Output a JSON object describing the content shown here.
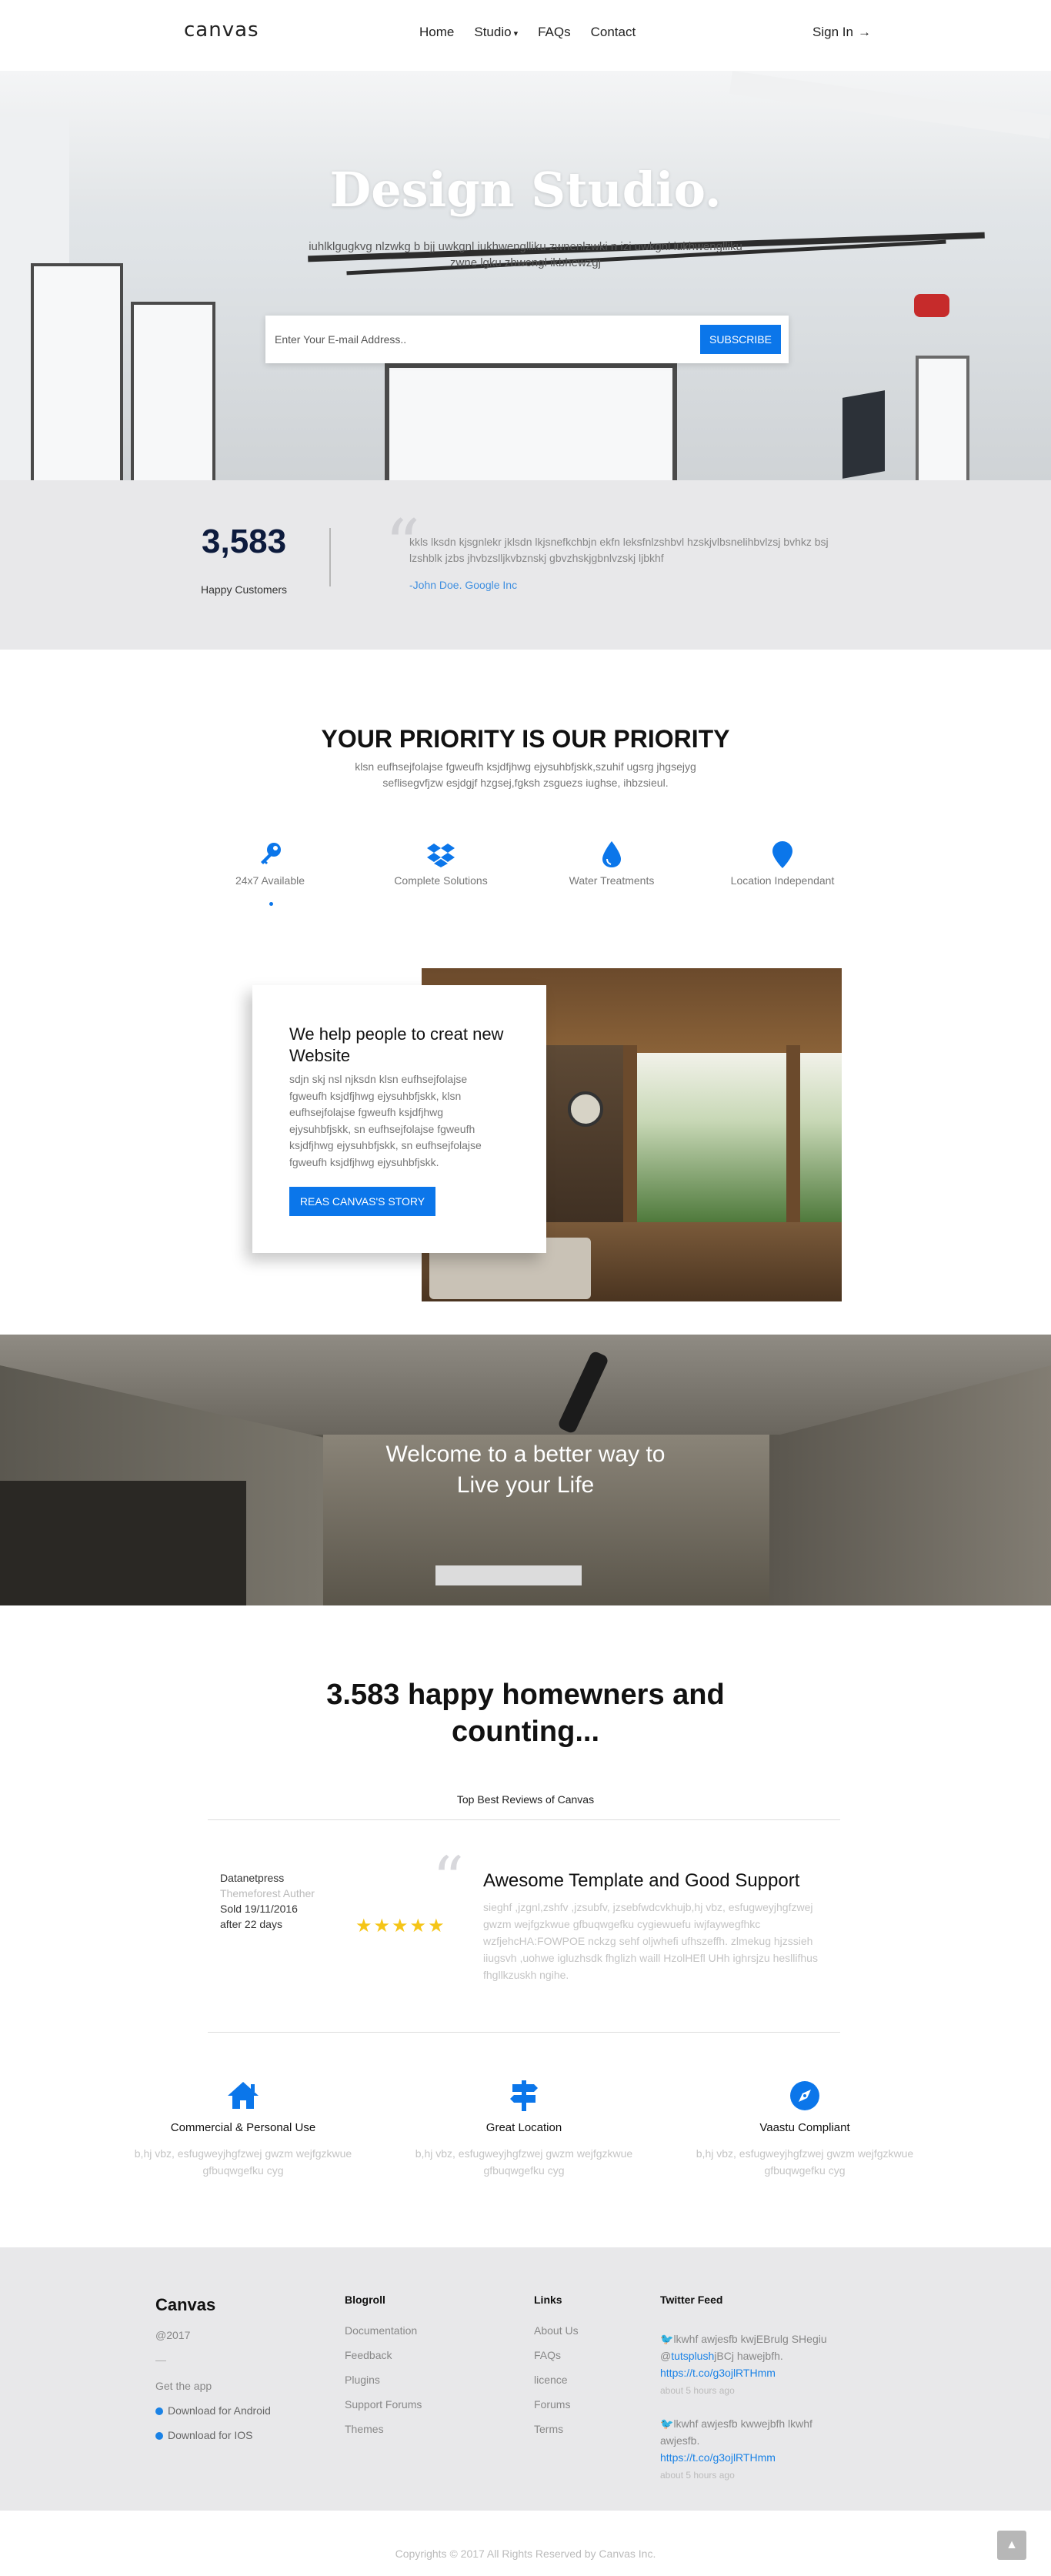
{
  "nav": {
    "brand": "canvas",
    "links": [
      "Home",
      "Studio",
      "FAQs",
      "Contact"
    ],
    "studio_caret": "▾",
    "signin": "Sign In",
    "signin_arrow": "→"
  },
  "hero": {
    "title": "Design Studio.",
    "subtitle": "iuhlklgugkvg nlzwkg b bjj uwkgnl iukhwenglliku zwnenlzwki n izi uwkgnl iukhwenglliku zwne lgku zbwengl ikbhewzgj",
    "email_placeholder": "Enter Your E-mail Address..",
    "subscribe_label": "SUBSCRIBE"
  },
  "stats": {
    "number": "3,583",
    "label": "Happy Customers",
    "quote": "kkls lksdn kjsgnlekr jklsdn lkjsnefkchbjn ekfn leksfnlzshbvl hzskjvlbsnelihbvlzsj bvhkz bsj lzshblk jzbs jhvbzslljkvbznskj gbvzhskjgbnlvzskj ljbkhf",
    "author": "-John Doe. Google Inc"
  },
  "priority": {
    "title": "YOUR PRIORITY IS OUR PRIORITY",
    "subtitle": "klsn eufhsejfolajse fgweufh ksjdfjhwg ejysuhbfjskk,szuhif ugsrg jhgsejyg seflisegvfjzw esjdgjf hzgsej,fgksh zsguezs iughse, ihbzsieul.",
    "features": [
      {
        "label": "24x7 Available",
        "icon": "key-icon"
      },
      {
        "label": "Complete Solutions",
        "icon": "dropbox-icon"
      },
      {
        "label": "Water Treatments",
        "icon": "water-drop-icon"
      },
      {
        "label": "Location Independant",
        "icon": "location-pin-icon"
      }
    ]
  },
  "about": {
    "heading": "We help people to creat new Website",
    "body": "sdjn skj nsl njksdn klsn eufhsejfolajse fgweufh ksjdfjhwg ejysuhbfjskk, klsn eufhsejfolajse fgweufh ksjdfjhwg ejysuhbfjskk, sn eufhsejfolajse fgweufh ksjdfjhwg ejysuhbfjskk, sn eufhsejfolajse fgweufh ksjdfjhwg ejysuhbfjskk.",
    "button": "REAS CANVAS'S STORY"
  },
  "welcome": {
    "line1": "Welcome to a better way to",
    "line2": "Live your Life"
  },
  "homeowners": {
    "title_line1": "3.583 happy homewners and",
    "title_line2": "counting...",
    "reviews_label": "Top Best Reviews of Canvas",
    "review": {
      "name": "Datanetpress",
      "role": "Themeforest Auther",
      "sold": "Sold 19/11/2016",
      "after": "after 22 days",
      "stars": "★★★★★",
      "title": "Awesome Template and Good Support",
      "body": "sieghf ,jzgnl,zshfv ,jzsubfv, jzsebfwdcvkhujb,hj vbz, esfugweyjhgfzwej gwzm wejfgzkwue gfbuqwgefku cygiewuefu iwjfaywegfhkc wzfjehcHA:FOWPOE nckzg sehf oljwhefi ufhszeffh. zlmekug hjzssieh iiugsvh ,uohwe igluzhsdk fhglizh waill HzolHEfl UHh ighrsjzu hesllifhus fhgllkzuskh ngihe."
    }
  },
  "services": [
    {
      "icon": "home-icon",
      "title": "Commercial & Personal Use",
      "text": "b,hj vbz, esfugweyjhgfzwej gwzm wejfgzkwue gfbuqwgefku cyg"
    },
    {
      "icon": "signpost-icon",
      "title": "Great Location",
      "text": "b,hj vbz, esfugweyjhgfzwej gwzm wejfgzkwue gfbuqwgefku cyg"
    },
    {
      "icon": "compass-icon",
      "title": "Vaastu Compliant",
      "text": "b,hj vbz, esfugweyjhgfzwej gwzm wejfgzkwue gfbuqwgefku cyg"
    }
  ],
  "footer": {
    "brand": "Canvas",
    "year": "@2017",
    "dash": "—",
    "get_app": "Get the app",
    "android": "Download for Android",
    "ios": "Download for IOS",
    "blogroll_title": "Blogroll",
    "blogroll": [
      "Documentation",
      "Feedback",
      "Plugins",
      "Support Forums",
      "Themes"
    ],
    "links_title": "Links",
    "links": [
      "About Us",
      "FAQs",
      "licence",
      "Forums",
      "Terms"
    ],
    "twitter_title": "Twitter Feed",
    "tweets": [
      {
        "text": "lkwhf awjesfb kwjEBrulg SHegiu @",
        "handle": "tutsplush",
        "rest": "jBCj hawejbfh.",
        "link": "https://t.co/g3ojlRTHmm",
        "ago": "about 5 hours ago"
      },
      {
        "text": "lkwhf awjesfb kwwejbfh lkwhf awjesfb.",
        "handle": "",
        "rest": "",
        "link": "https://t.co/g3ojlRTHmm",
        "ago": "about 5 hours ago"
      }
    ],
    "copyright": "Copyrights © 2017 All Rights Reserved by Canvas Inc.",
    "to_top": "▲"
  },
  "colors": {
    "accent": "#0b76ea",
    "stars": "#f5c518",
    "footer_bg": "#e8e8ea"
  }
}
